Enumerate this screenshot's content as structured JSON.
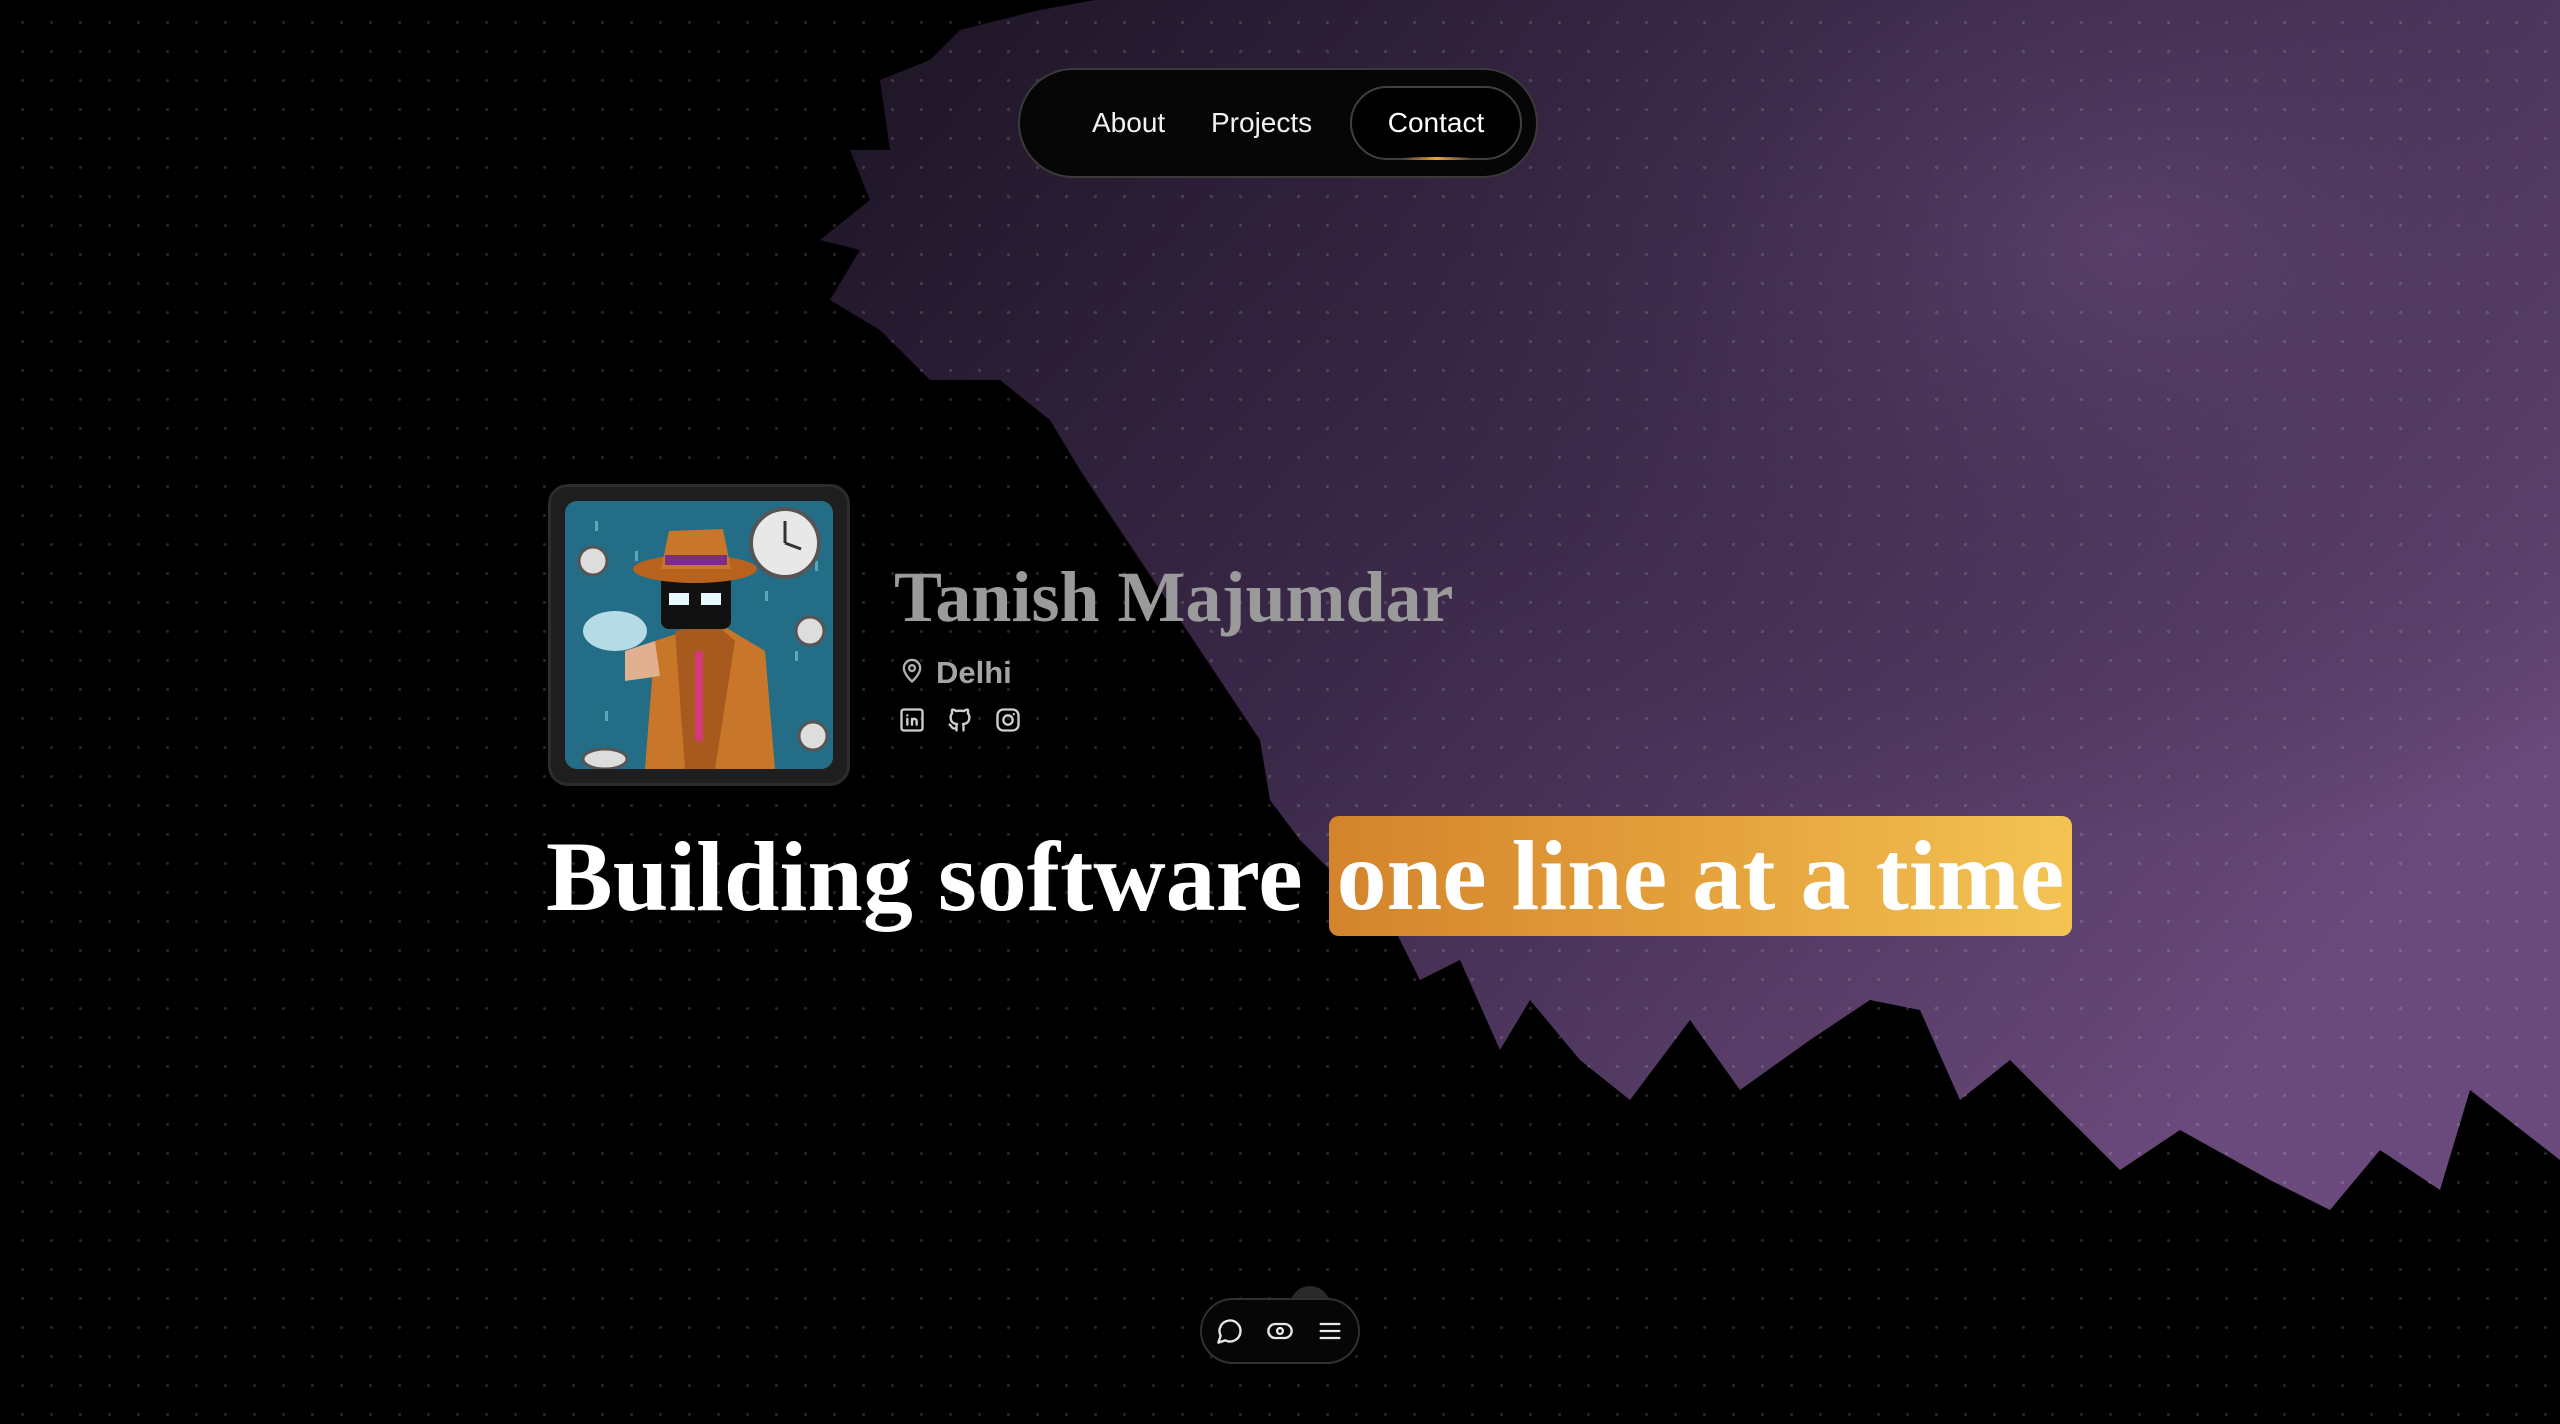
{
  "nav": {
    "about": "About",
    "projects": "Projects",
    "contact": "Contact"
  },
  "profile": {
    "name": "Tanish Majumdar",
    "location": "Delhi",
    "socials": [
      "linkedin-icon",
      "github-icon",
      "instagram-icon"
    ]
  },
  "headline": {
    "prefix": "Building software",
    "highlight": "one line at a time"
  },
  "toolbar": {
    "buttons": [
      "chat-icon",
      "eye-icon",
      "menu-icon"
    ]
  },
  "colors": {
    "background": "#000000",
    "accent_start": "#d3842c",
    "accent_end": "#f3c453",
    "backdrop_purple": "#6a4a7c"
  }
}
